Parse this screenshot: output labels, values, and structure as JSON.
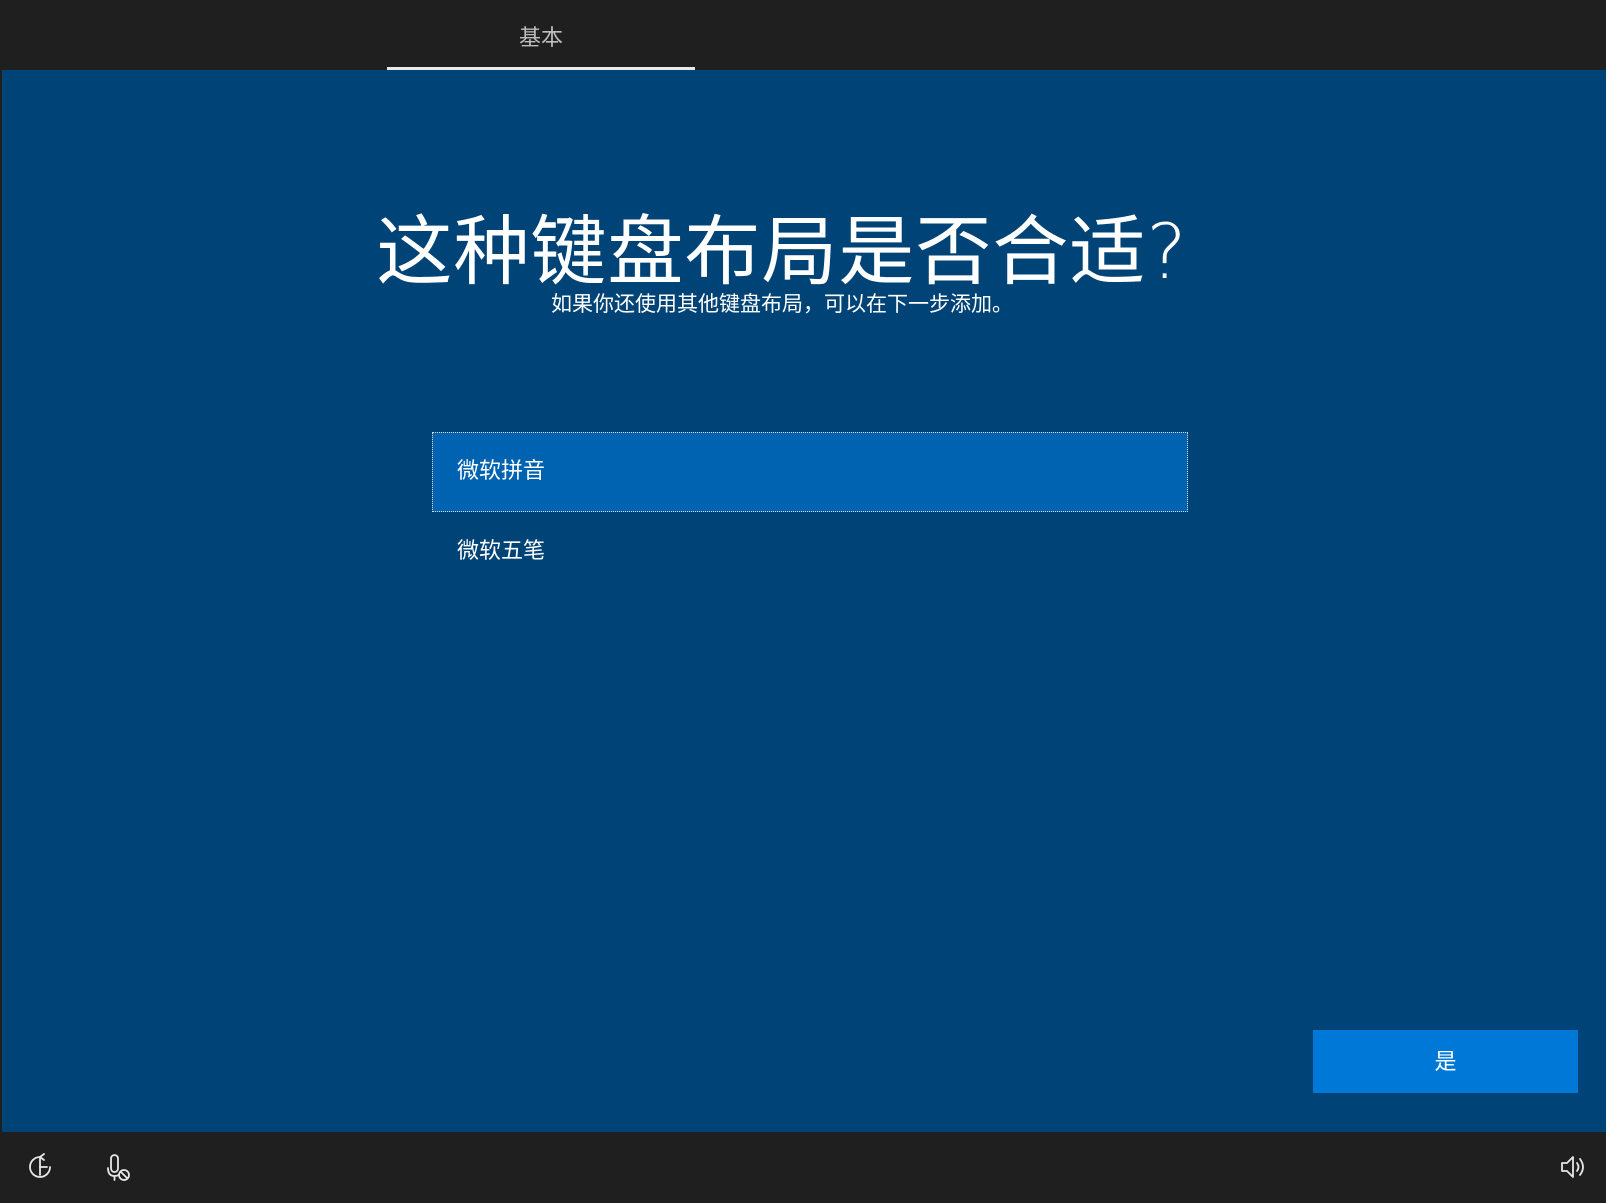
{
  "header": {
    "tabs": [
      {
        "label": "基本",
        "active": true
      }
    ]
  },
  "main": {
    "title": "这种键盘布局是否合适?",
    "subtitle": "如果你还使用其他键盘布局，可以在下一步添加。",
    "layouts": [
      {
        "label": "微软拼音",
        "selected": true
      },
      {
        "label": "微软五笔",
        "selected": false
      }
    ],
    "confirm_label": "是"
  },
  "footer": {
    "icons": [
      "ease-of-access-icon",
      "microphone-muted-icon",
      "volume-icon"
    ]
  },
  "colors": {
    "background": "#004376",
    "bars": "#1f1f1f",
    "selected_item": "#0063b1",
    "button": "#0078d7"
  }
}
